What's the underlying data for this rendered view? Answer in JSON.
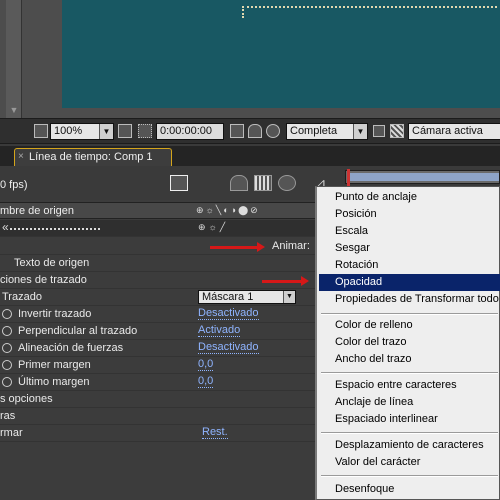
{
  "viewer_toolbar": {
    "zoom": "100%",
    "timecode": "0:00:00:00",
    "resolution": "Completa",
    "camera": "Cámara activa"
  },
  "timeline_tab": {
    "label": "Línea de tiempo: Comp 1"
  },
  "timeline": {
    "fps": "0 fps)",
    "column_source_name": "mbre de origen",
    "animate_label": "Animar:",
    "rows": {
      "source_text": "Texto de origen",
      "path_options": "ciones de trazado",
      "path": "Trazado",
      "mask_value": "Máscara 1",
      "reverse_path": "Invertir trazado",
      "reverse_path_value": "Desactivado",
      "perpendicular": "Perpendicular al trazado",
      "perpendicular_value": "Activado",
      "force_align": "Alineación de fuerzas",
      "force_align_value": "Desactivado",
      "first_margin": "Primer margen",
      "first_margin_value": "0,0",
      "last_margin": "Último margen",
      "last_margin_value": "0,0",
      "more_options": "s opciones",
      "ras": "ras",
      "transform": "rmar",
      "reset": "Rest."
    }
  },
  "context_menu": {
    "items": [
      "Punto de anclaje",
      "Posición",
      "Escala",
      "Sesgar",
      "Rotación",
      "Opacidad",
      "Propiedades de Transformar todo",
      "Color de relleno",
      "Color del trazo",
      "Ancho del trazo",
      "Espacio entre caracteres",
      "Anclaje de línea",
      "Espaciado interlinear",
      "Desplazamiento de caracteres",
      "Valor del carácter",
      "Desenfoque"
    ],
    "highlighted": "Opacidad"
  },
  "colors": {
    "comp_background": "#185863",
    "menu_highlight": "#0a246a",
    "tab_border": "#d4a51c",
    "annotation_arrow": "#d61818",
    "link_value": "#8fb4ff"
  }
}
